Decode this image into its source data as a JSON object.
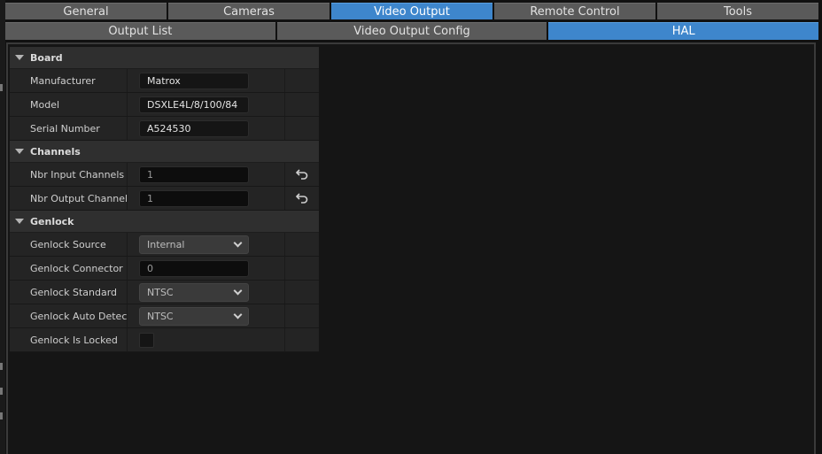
{
  "main_tabs": [
    {
      "label": "General",
      "active": false
    },
    {
      "label": "Cameras",
      "active": false
    },
    {
      "label": "Video Output",
      "active": true
    },
    {
      "label": "Remote Control",
      "active": false
    },
    {
      "label": "Tools",
      "active": false
    }
  ],
  "sub_tabs": [
    {
      "label": "Output List",
      "active": false
    },
    {
      "label": "Video Output Config",
      "active": false
    },
    {
      "label": "HAL",
      "active": true
    }
  ],
  "sections": {
    "board": {
      "title": "Board",
      "manufacturer": {
        "label": "Manufacturer",
        "value": "Matrox"
      },
      "model": {
        "label": "Model",
        "value": "DSXLE4L/8/100/84"
      },
      "serial": {
        "label": "Serial Number",
        "value": "A524530"
      }
    },
    "channels": {
      "title": "Channels",
      "input": {
        "label": "Nbr Input Channels",
        "value": "1"
      },
      "output": {
        "label": "Nbr Output Channels",
        "value": "1"
      }
    },
    "genlock": {
      "title": "Genlock",
      "source": {
        "label": "Genlock Source",
        "value": "Internal"
      },
      "connector": {
        "label": "Genlock Connector I...",
        "value": "0"
      },
      "standard": {
        "label": "Genlock Standard",
        "value": "NTSC"
      },
      "auto_detect": {
        "label": "Genlock Auto Detect...",
        "value": "NTSC"
      },
      "is_locked": {
        "label": "Genlock Is Locked",
        "checked": false
      }
    }
  },
  "colors": {
    "tab": "#5a5a5a",
    "active_tab": "#3e86cc",
    "panel_bg": "#151515",
    "row_bg": "#242424",
    "section_bg": "#2f2f2f"
  },
  "icons": {
    "section_toggle": "caret-down-icon",
    "reset": "reset-arrow-icon",
    "dropdown": "chevron-down-icon"
  }
}
